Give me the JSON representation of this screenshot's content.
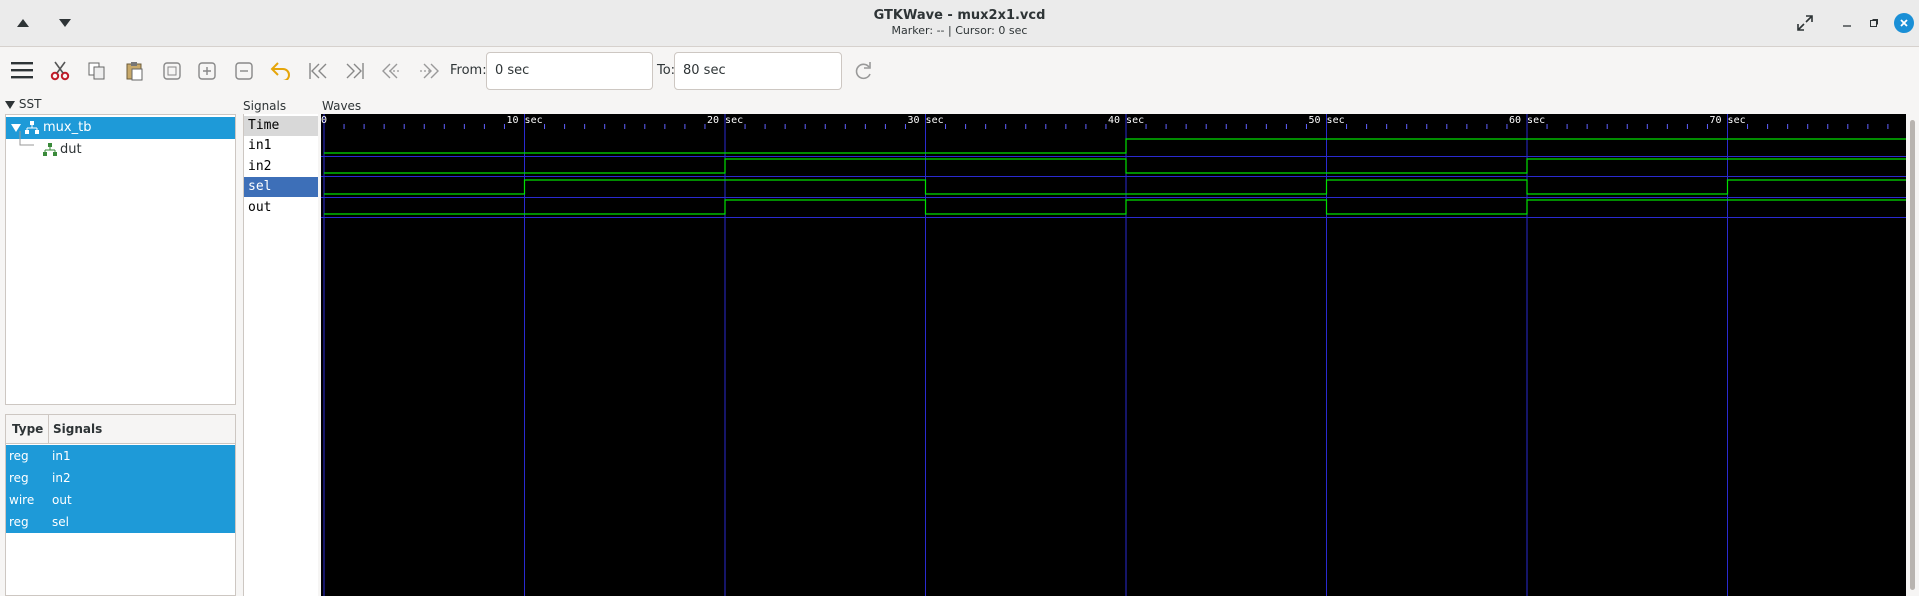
{
  "window": {
    "title": "GTKWave - mux2x1.vcd",
    "subtitle": "Marker: --  |  Cursor: 0 sec"
  },
  "toolbar": {
    "from_label": "From:",
    "from_value": "0 sec",
    "to_label": "To:",
    "to_value": "80 sec",
    "icons": [
      "menu-icon",
      "cut-icon",
      "copy-icon",
      "paste-icon",
      "zoom-fit-icon",
      "zoom-in-icon",
      "zoom-out-icon",
      "undo-icon",
      "first-icon",
      "last-icon",
      "prev-icon",
      "next-icon",
      "reload-icon"
    ]
  },
  "sst": {
    "label": "SST",
    "tree": [
      {
        "label": "mux_tb",
        "selected": true
      },
      {
        "label": "dut",
        "selected": false
      }
    ]
  },
  "signal_table": {
    "headers": [
      "Type",
      "Signals"
    ],
    "rows": [
      {
        "type": "reg",
        "name": "in1"
      },
      {
        "type": "reg",
        "name": "in2"
      },
      {
        "type": "wire",
        "name": "out"
      },
      {
        "type": "reg",
        "name": "sel"
      }
    ]
  },
  "signals_pane": {
    "label": "Signals",
    "names": [
      "Time",
      "in1",
      "in2",
      "sel",
      "out"
    ]
  },
  "waves_pane": {
    "label": "Waves",
    "time_labels": [
      "0",
      "10 sec",
      "20 sec",
      "30 sec",
      "40 sec",
      "50 sec",
      "60 sec",
      "70 sec"
    ],
    "trace_color": "#00e000",
    "grid_color": "#2a2ad0"
  },
  "chart_data": {
    "type": "line",
    "xlabel": "",
    "ylabel": "",
    "xlim": [
      0,
      79
    ],
    "x_ticks": [
      0,
      10,
      20,
      30,
      40,
      50,
      60,
      70
    ],
    "tick_unit": "sec",
    "series": [
      {
        "name": "in1",
        "transitions": [
          [
            0,
            0
          ],
          [
            40,
            1
          ]
        ]
      },
      {
        "name": "in2",
        "transitions": [
          [
            0,
            0
          ],
          [
            20,
            1
          ],
          [
            40,
            0
          ],
          [
            60,
            1
          ]
        ]
      },
      {
        "name": "sel",
        "transitions": [
          [
            0,
            0
          ],
          [
            10,
            1
          ],
          [
            30,
            0
          ],
          [
            50,
            1
          ],
          [
            60,
            0
          ],
          [
            70,
            1
          ]
        ]
      },
      {
        "name": "out",
        "transitions": [
          [
            0,
            0
          ],
          [
            20,
            1
          ],
          [
            30,
            0
          ],
          [
            40,
            1
          ],
          [
            50,
            0
          ],
          [
            60,
            1
          ]
        ]
      }
    ]
  }
}
